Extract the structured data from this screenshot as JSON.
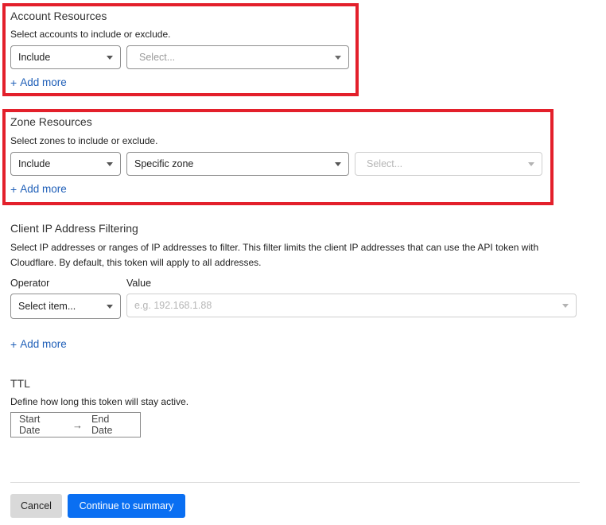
{
  "account_resources": {
    "title": "Account Resources",
    "description": "Select accounts to include or exclude.",
    "operator_value": "Include",
    "account_placeholder": "Select...",
    "add_more": "Add more"
  },
  "zone_resources": {
    "title": "Zone Resources",
    "description": "Select zones to include or exclude.",
    "operator_value": "Include",
    "scope_value": "Specific zone",
    "zone_placeholder": "Select...",
    "add_more": "Add more"
  },
  "ip_filtering": {
    "title": "Client IP Address Filtering",
    "description_line1": "Select IP addresses or ranges of IP addresses to filter. This filter limits the client IP addresses that can use the API token with",
    "description_line2": "Cloudflare. By default, this token will apply to all addresses.",
    "operator_label": "Operator",
    "value_label": "Value",
    "operator_placeholder": "Select item...",
    "value_placeholder": "e.g. 192.168.1.88",
    "add_more": "Add more"
  },
  "ttl": {
    "title": "TTL",
    "description": "Define how long this token will stay active.",
    "start_date": "Start Date",
    "end_date": "End Date"
  },
  "footer": {
    "cancel_label": "Cancel",
    "continue_label": "Continue to summary"
  },
  "colors": {
    "highlight": "#e3202b",
    "link": "#1f5fb8",
    "primary_button": "#0a6ff2",
    "cancel_button": "#d9d9d9"
  },
  "icons": {
    "add": "plus-icon",
    "dropdown": "caret-down-icon",
    "date_arrow": "arrow-right-icon"
  }
}
